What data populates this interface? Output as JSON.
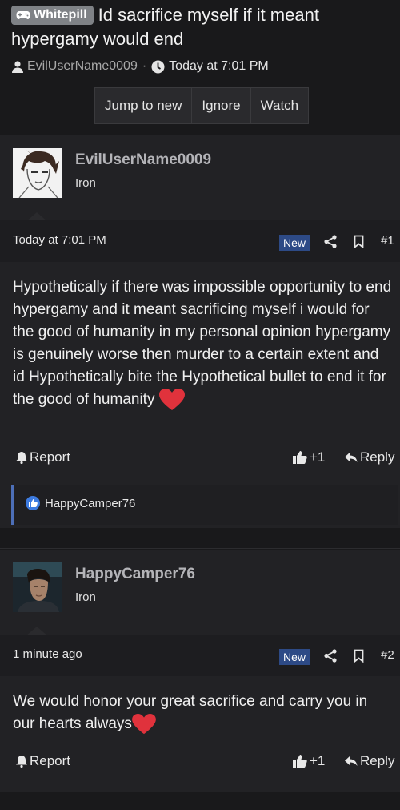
{
  "thread": {
    "prefix": "Whitepill",
    "title": "Id sacrifice myself if it meant hypergamy would end",
    "author": "EvilUserName0009",
    "separator": "·",
    "time": "Today at 7:01 PM"
  },
  "buttons": {
    "jump": "Jump to new",
    "ignore": "Ignore",
    "watch": "Watch"
  },
  "posts": [
    {
      "username": "EvilUserName0009",
      "rank": "Iron",
      "time": "Today at 7:01 PM",
      "badge": "New",
      "number": "#1",
      "body": "Hypothetically if there was impossible opportunity to end hypergamy and it meant sacrificing myself i would for the good of humanity in my personal opinion hypergamy is genuinely worse then murder to a certain extent and id Hypothetically bite the Hypothetical bullet to end it for the good of humanity",
      "report": "Report",
      "likes": "+1",
      "reply": "Reply",
      "liked_by": "HappyCamper76"
    },
    {
      "username": "HappyCamper76",
      "rank": "Iron",
      "time": "1 minute ago",
      "badge": "New",
      "number": "#2",
      "body": "We would honor your great sacrifice and carry you in our hearts always",
      "report": "Report",
      "likes": "+1",
      "reply": "Reply"
    }
  ],
  "colors": {
    "background": "#19191b",
    "post_bg": "#222225",
    "badge": "#2d4a86",
    "prefix_bg": "#7f8286",
    "heart": "#e0323c",
    "like_accent": "#4d6fb8"
  },
  "icons": [
    "gamepad-icon",
    "user-icon",
    "clock-icon",
    "share-icon",
    "bookmark-icon",
    "bell-icon",
    "thumbs-up-icon",
    "reply-icon",
    "heart-icon",
    "like-badge-icon"
  ]
}
